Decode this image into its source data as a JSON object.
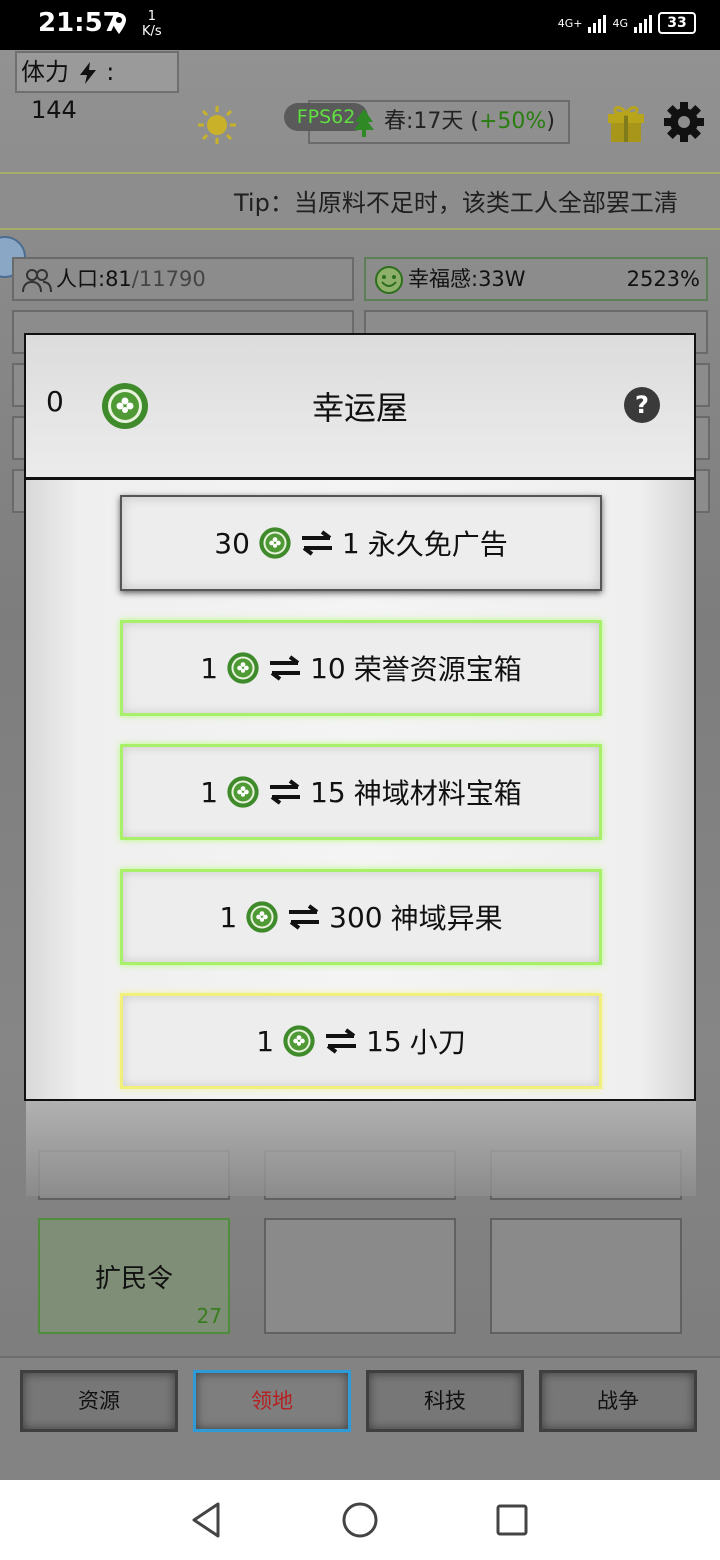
{
  "status_bar": {
    "time": "21:57",
    "speed_value": "1",
    "speed_unit": "K/s",
    "network_1": "4G+",
    "network_2": "4G",
    "battery": "33"
  },
  "hud": {
    "stamina_label": "体力",
    "stamina_value": "144",
    "fps": "FPS62",
    "season_text": "春:17天 (",
    "season_bonus": "+50%",
    "season_close": ")",
    "tip": "Tip：当原料不足时，该类工人全部罢工清",
    "population_label": "人口:81",
    "population_cap": "/11790",
    "happiness_label": "幸福感:33W",
    "happiness_pct": "2523%"
  },
  "modal": {
    "coin_count": "0",
    "title": "幸运屋",
    "help": "?",
    "trades": [
      {
        "cost": "30",
        "amount": "1",
        "item": "永久免广告",
        "style": "gray"
      },
      {
        "cost": "1",
        "amount": "10",
        "item": "荣誉资源宝箱",
        "style": "green"
      },
      {
        "cost": "1",
        "amount": "15",
        "item": "神域材料宝箱",
        "style": "green"
      },
      {
        "cost": "1",
        "amount": "300",
        "item": "神域异果",
        "style": "green"
      },
      {
        "cost": "1",
        "amount": "15",
        "item": "小刀",
        "style": "yellow"
      }
    ]
  },
  "cards": [
    {
      "label": "扩民令",
      "count": "27"
    }
  ],
  "bottom_nav": [
    "资源",
    "领地",
    "科技",
    "战争"
  ],
  "colors": {
    "accent_green": "#a8ef6a",
    "accent_yellow": "#f0f07a",
    "active_tab_border": "#2f9bd6",
    "coin_green": "#3f8a2a"
  }
}
